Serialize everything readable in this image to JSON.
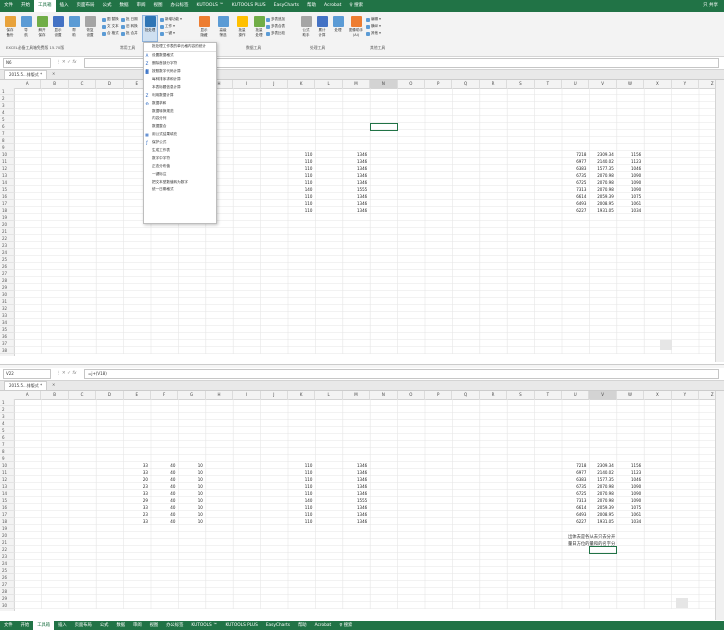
{
  "menu": {
    "items": [
      "文件",
      "开始",
      "工具箱",
      "插入",
      "页面布局",
      "公式",
      "数据",
      "审阅",
      "视图",
      "办公标签",
      "KUTOOLS ™",
      "KUTOOLS PLUS",
      "EasyCharts",
      "帮助",
      "Acrobat",
      "♀ 搜索"
    ],
    "active_index": 2,
    "share": "只 共享"
  },
  "ribbon": {
    "buttons": [
      {
        "label": "保存\n备份",
        "color": "#e8a33c"
      },
      {
        "label": "导\n航",
        "color": "#5b9bd5"
      },
      {
        "label": "解开\n保存",
        "color": "#70ad47"
      },
      {
        "label": "显示\n设置",
        "color": "#4472c4"
      },
      {
        "label": "帮\n助",
        "color": "#5b9bd5"
      },
      {
        "label": "恢复\n设置",
        "color": "#a5a5a5"
      }
    ],
    "small_left": [
      "图 替换",
      "文 文本",
      "合 格式"
    ],
    "small_mid": [
      "批 日期",
      "旧 转换",
      "批 合并"
    ],
    "big_active": {
      "label": "批处理",
      "color": "#2f75b5"
    },
    "small_r1": [
      "新增功能 ▾",
      "工作 ▾",
      "一键 ▾"
    ],
    "buttons_right": [
      {
        "label": "显示\n隐藏",
        "color": "#ed7d31"
      },
      {
        "label": "高级\n筛选",
        "color": "#5b9bd5"
      },
      {
        "label": "批量\n操作",
        "color": "#ffc000"
      },
      {
        "label": "批量\n处理",
        "color": "#70ad47"
      },
      {
        "label": "公式\n助手",
        "color": "#a5a5a5"
      },
      {
        "label": "累计\n计算",
        "color": "#4472c4"
      },
      {
        "label": "处理",
        "color": "#5b9bd5"
      },
      {
        "label": "图像助手\n(Ai)",
        "color": "#ed7d31"
      }
    ],
    "small_r2": [
      "多表追加",
      "多表合表",
      "多表比较"
    ],
    "small_r3": [
      "编辑 ▾",
      "横纵 ▾",
      "其他 ▾"
    ],
    "group_names": [
      "EXCEL必备工具箱免费版 15.70版",
      "常用工具",
      "数据工具",
      "处理工具",
      "其他工具"
    ]
  },
  "top": {
    "namebox": "N6",
    "formula": "",
    "tab": "2015.5...排版式 *",
    "tab_x": "✕"
  },
  "bottom_pane": {
    "namebox": "V22",
    "formula": "=j+(V18)",
    "tab": "2015.5...排版式 *",
    "tab_x": "✕"
  },
  "columns": [
    "A",
    "B",
    "C",
    "D",
    "E",
    "F",
    "G",
    "H",
    "I",
    "J",
    "K",
    "L",
    "M",
    "N",
    "O",
    "P",
    "Q",
    "R",
    "S",
    "T",
    "U",
    "V",
    "W",
    "X",
    "Y",
    "Z"
  ],
  "top_rows": 38,
  "bottom_rows": 30,
  "top_values": [
    {
      "row": 10,
      "K": "110",
      "M": "1346",
      "U": "7218",
      "V": "2309.34",
      "W": "1156"
    },
    {
      "row": 11,
      "K": "110",
      "M": "1346",
      "U": "6977",
      "V": "2140.02",
      "W": "1123"
    },
    {
      "row": 12,
      "K": "110",
      "M": "1346",
      "U": "6383",
      "V": "1577.35",
      "W": "1046"
    },
    {
      "row": 13,
      "K": "110",
      "M": "1346",
      "U": "6735",
      "V": "2070.98",
      "W": "1090"
    },
    {
      "row": 14,
      "K": "110",
      "M": "1346",
      "U": "6725",
      "V": "2070.98",
      "W": "1090"
    },
    {
      "row": 15,
      "K": "140",
      "M": "1555",
      "U": "7313",
      "V": "2070.98",
      "W": "1090"
    },
    {
      "row": 16,
      "K": "110",
      "M": "1346",
      "U": "6614",
      "V": "2059.39",
      "W": "1075"
    },
    {
      "row": 17,
      "K": "110",
      "M": "1346",
      "U": "6493",
      "V": "2008.95",
      "W": "1061"
    },
    {
      "row": 18,
      "K": "110",
      "M": "1346",
      "U": "6227",
      "V": "1931.05",
      "W": "1034"
    }
  ],
  "bottom_values": [
    {
      "row": 10,
      "E": "33",
      "F": "40",
      "G": "10",
      "K": "110",
      "M": "1346",
      "U": "7218",
      "V": "2309.34",
      "W": "1156"
    },
    {
      "row": 11,
      "E": "33",
      "F": "40",
      "G": "10",
      "K": "110",
      "M": "1346",
      "U": "6977",
      "V": "2140.02",
      "W": "1123"
    },
    {
      "row": 12,
      "E": "20",
      "F": "40",
      "G": "10",
      "K": "110",
      "M": "1346",
      "U": "6383",
      "V": "1577.35",
      "W": "1046"
    },
    {
      "row": 13,
      "E": "23",
      "F": "40",
      "G": "10",
      "K": "110",
      "M": "1346",
      "U": "6735",
      "V": "2070.98",
      "W": "1090"
    },
    {
      "row": 14,
      "E": "33",
      "F": "40",
      "G": "10",
      "K": "110",
      "M": "1346",
      "U": "6725",
      "V": "2070.98",
      "W": "1090"
    },
    {
      "row": 15,
      "E": "29",
      "F": "40",
      "G": "10",
      "K": "140",
      "M": "1555",
      "U": "7313",
      "V": "2070.98",
      "W": "1090"
    },
    {
      "row": 16,
      "E": "33",
      "F": "40",
      "G": "10",
      "K": "110",
      "M": "1346",
      "U": "6614",
      "V": "2059.39",
      "W": "1075"
    },
    {
      "row": 17,
      "E": "23",
      "F": "40",
      "G": "10",
      "K": "110",
      "M": "1346",
      "U": "6493",
      "V": "2008.95",
      "W": "1061"
    },
    {
      "row": 18,
      "E": "33",
      "F": "40",
      "G": "10",
      "K": "110",
      "M": "1346",
      "U": "6227",
      "V": "1931.05",
      "W": "1034"
    }
  ],
  "notes": [
    "出体去是各从去只去分开",
    "量日方位的量和的名字分"
  ],
  "dropdown": {
    "items": [
      {
        "icon": "",
        "label": "批处理工作表的单元格内容的统计"
      },
      {
        "icon": "A",
        "label": "设置数据格式"
      },
      {
        "icon": "Z",
        "label": "删除首部分字符"
      },
      {
        "icon": "▓",
        "label": "按照数字代码计算"
      },
      {
        "icon": "",
        "label": "每种排序求和计算"
      },
      {
        "icon": "",
        "label": "本表标题信息计算"
      },
      {
        "icon": "Z",
        "label": "利用数据计算"
      },
      {
        "icon": "⟰",
        "label": "数据求和"
      },
      {
        "icon": "",
        "label": "数据转换规范"
      },
      {
        "icon": "",
        "label": "内容分列"
      },
      {
        "icon": "",
        "label": "数据整合"
      },
      {
        "icon": "▦",
        "label": "用公式结果填充"
      },
      {
        "icon": "ƒ",
        "label": "保护公式"
      },
      {
        "icon": "",
        "label": "生成工作表"
      },
      {
        "icon": "",
        "label": "数字中字符"
      },
      {
        "icon": "",
        "label": "正态分布值"
      },
      {
        "icon": "",
        "label": "一键标注"
      },
      {
        "icon": "",
        "label": "把文本型数值转为数字"
      },
      {
        "icon": "",
        "label": "统一日期格式"
      }
    ]
  }
}
